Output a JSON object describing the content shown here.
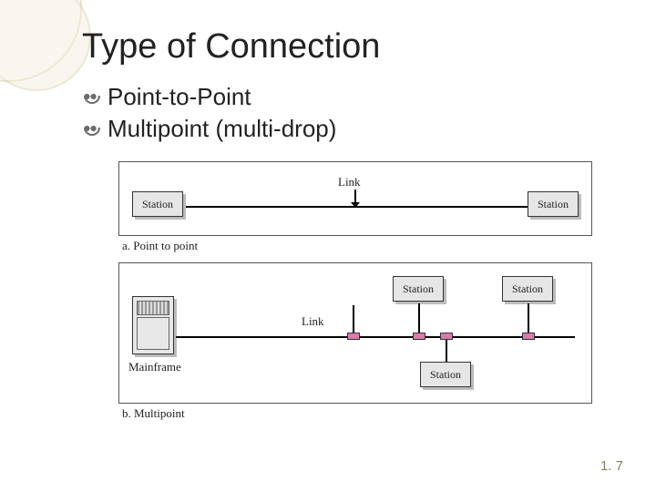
{
  "title": "Type of Connection",
  "bullets": [
    "Point-to-Point",
    "Multipoint (multi-drop)"
  ],
  "figure": {
    "panelA": {
      "caption": "a. Point to point",
      "link_label": "Link",
      "left_station": "Station",
      "right_station": "Station"
    },
    "panelB": {
      "caption": "b. Multipoint",
      "link_label": "Link",
      "mainframe_label": "Mainframe",
      "station1": "Station",
      "station2": "Station",
      "station3": "Station"
    }
  },
  "page_number": "1. 7"
}
